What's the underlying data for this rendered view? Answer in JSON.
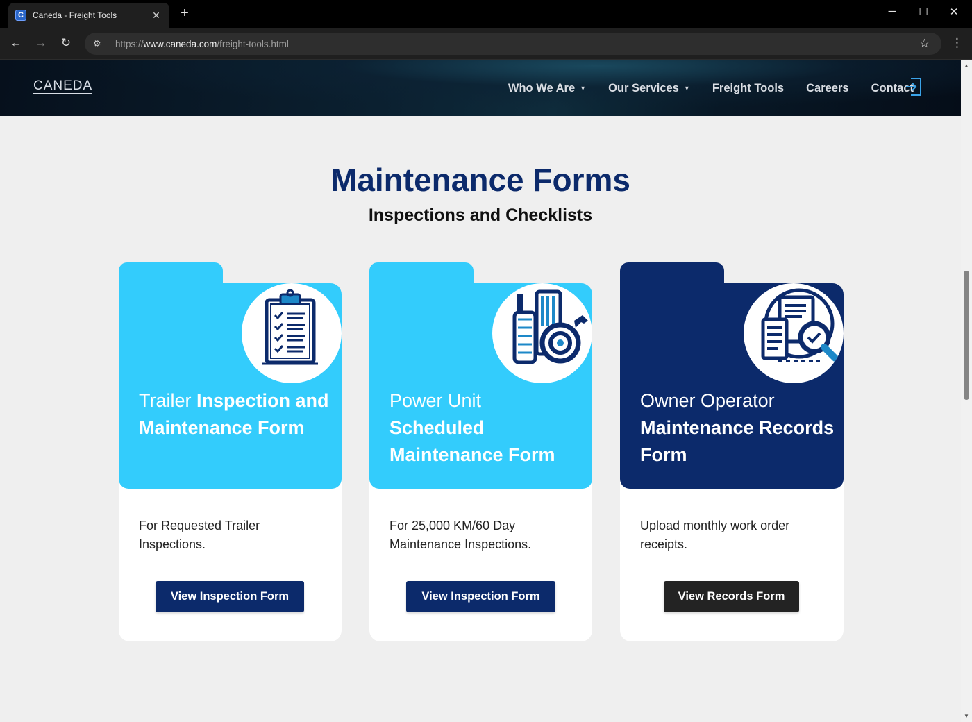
{
  "browser": {
    "tab_title": "Caneda - Freight Tools",
    "favicon_letter": "C",
    "url_prefix": "https://",
    "url_host": "www.caneda.com",
    "url_path": "/freight-tools.html"
  },
  "header": {
    "logo": "CANEDA",
    "nav": [
      {
        "label": "Who We Are",
        "dropdown": true
      },
      {
        "label": "Our Services",
        "dropdown": true
      },
      {
        "label": "Freight Tools",
        "dropdown": false
      },
      {
        "label": "Careers",
        "dropdown": false
      },
      {
        "label": "Contact",
        "dropdown": false
      }
    ],
    "login_icon": "login-icon"
  },
  "page": {
    "title": "Maintenance Forms",
    "subtitle": "Inspections and Checklists"
  },
  "cards": [
    {
      "title_light": "Trailer ",
      "title_strong": "Inspection and Maintenance Form",
      "description": "For Requested Trailer Inspections.",
      "button": "View Inspection Form",
      "icon": "clipboard-checklist-icon",
      "panel_color": "#33ccfc",
      "button_color": "#0c2a6b"
    },
    {
      "title_light": "Power Unit",
      "title_strong": "Scheduled Maintenance Form",
      "description": "For 25,000 KM/60 Day Maintenance Inspections.",
      "button": "View Inspection Form",
      "icon": "engine-parts-icon",
      "panel_color": "#33ccfc",
      "button_color": "#0c2a6b"
    },
    {
      "title_light": "Owner Operator",
      "title_strong": "Maintenance Records Form",
      "description": "Upload monthly work order receipts.",
      "button": "View Records Form",
      "icon": "records-magnifier-icon",
      "panel_color": "#0c2a6b",
      "button_color": "#232323"
    }
  ]
}
